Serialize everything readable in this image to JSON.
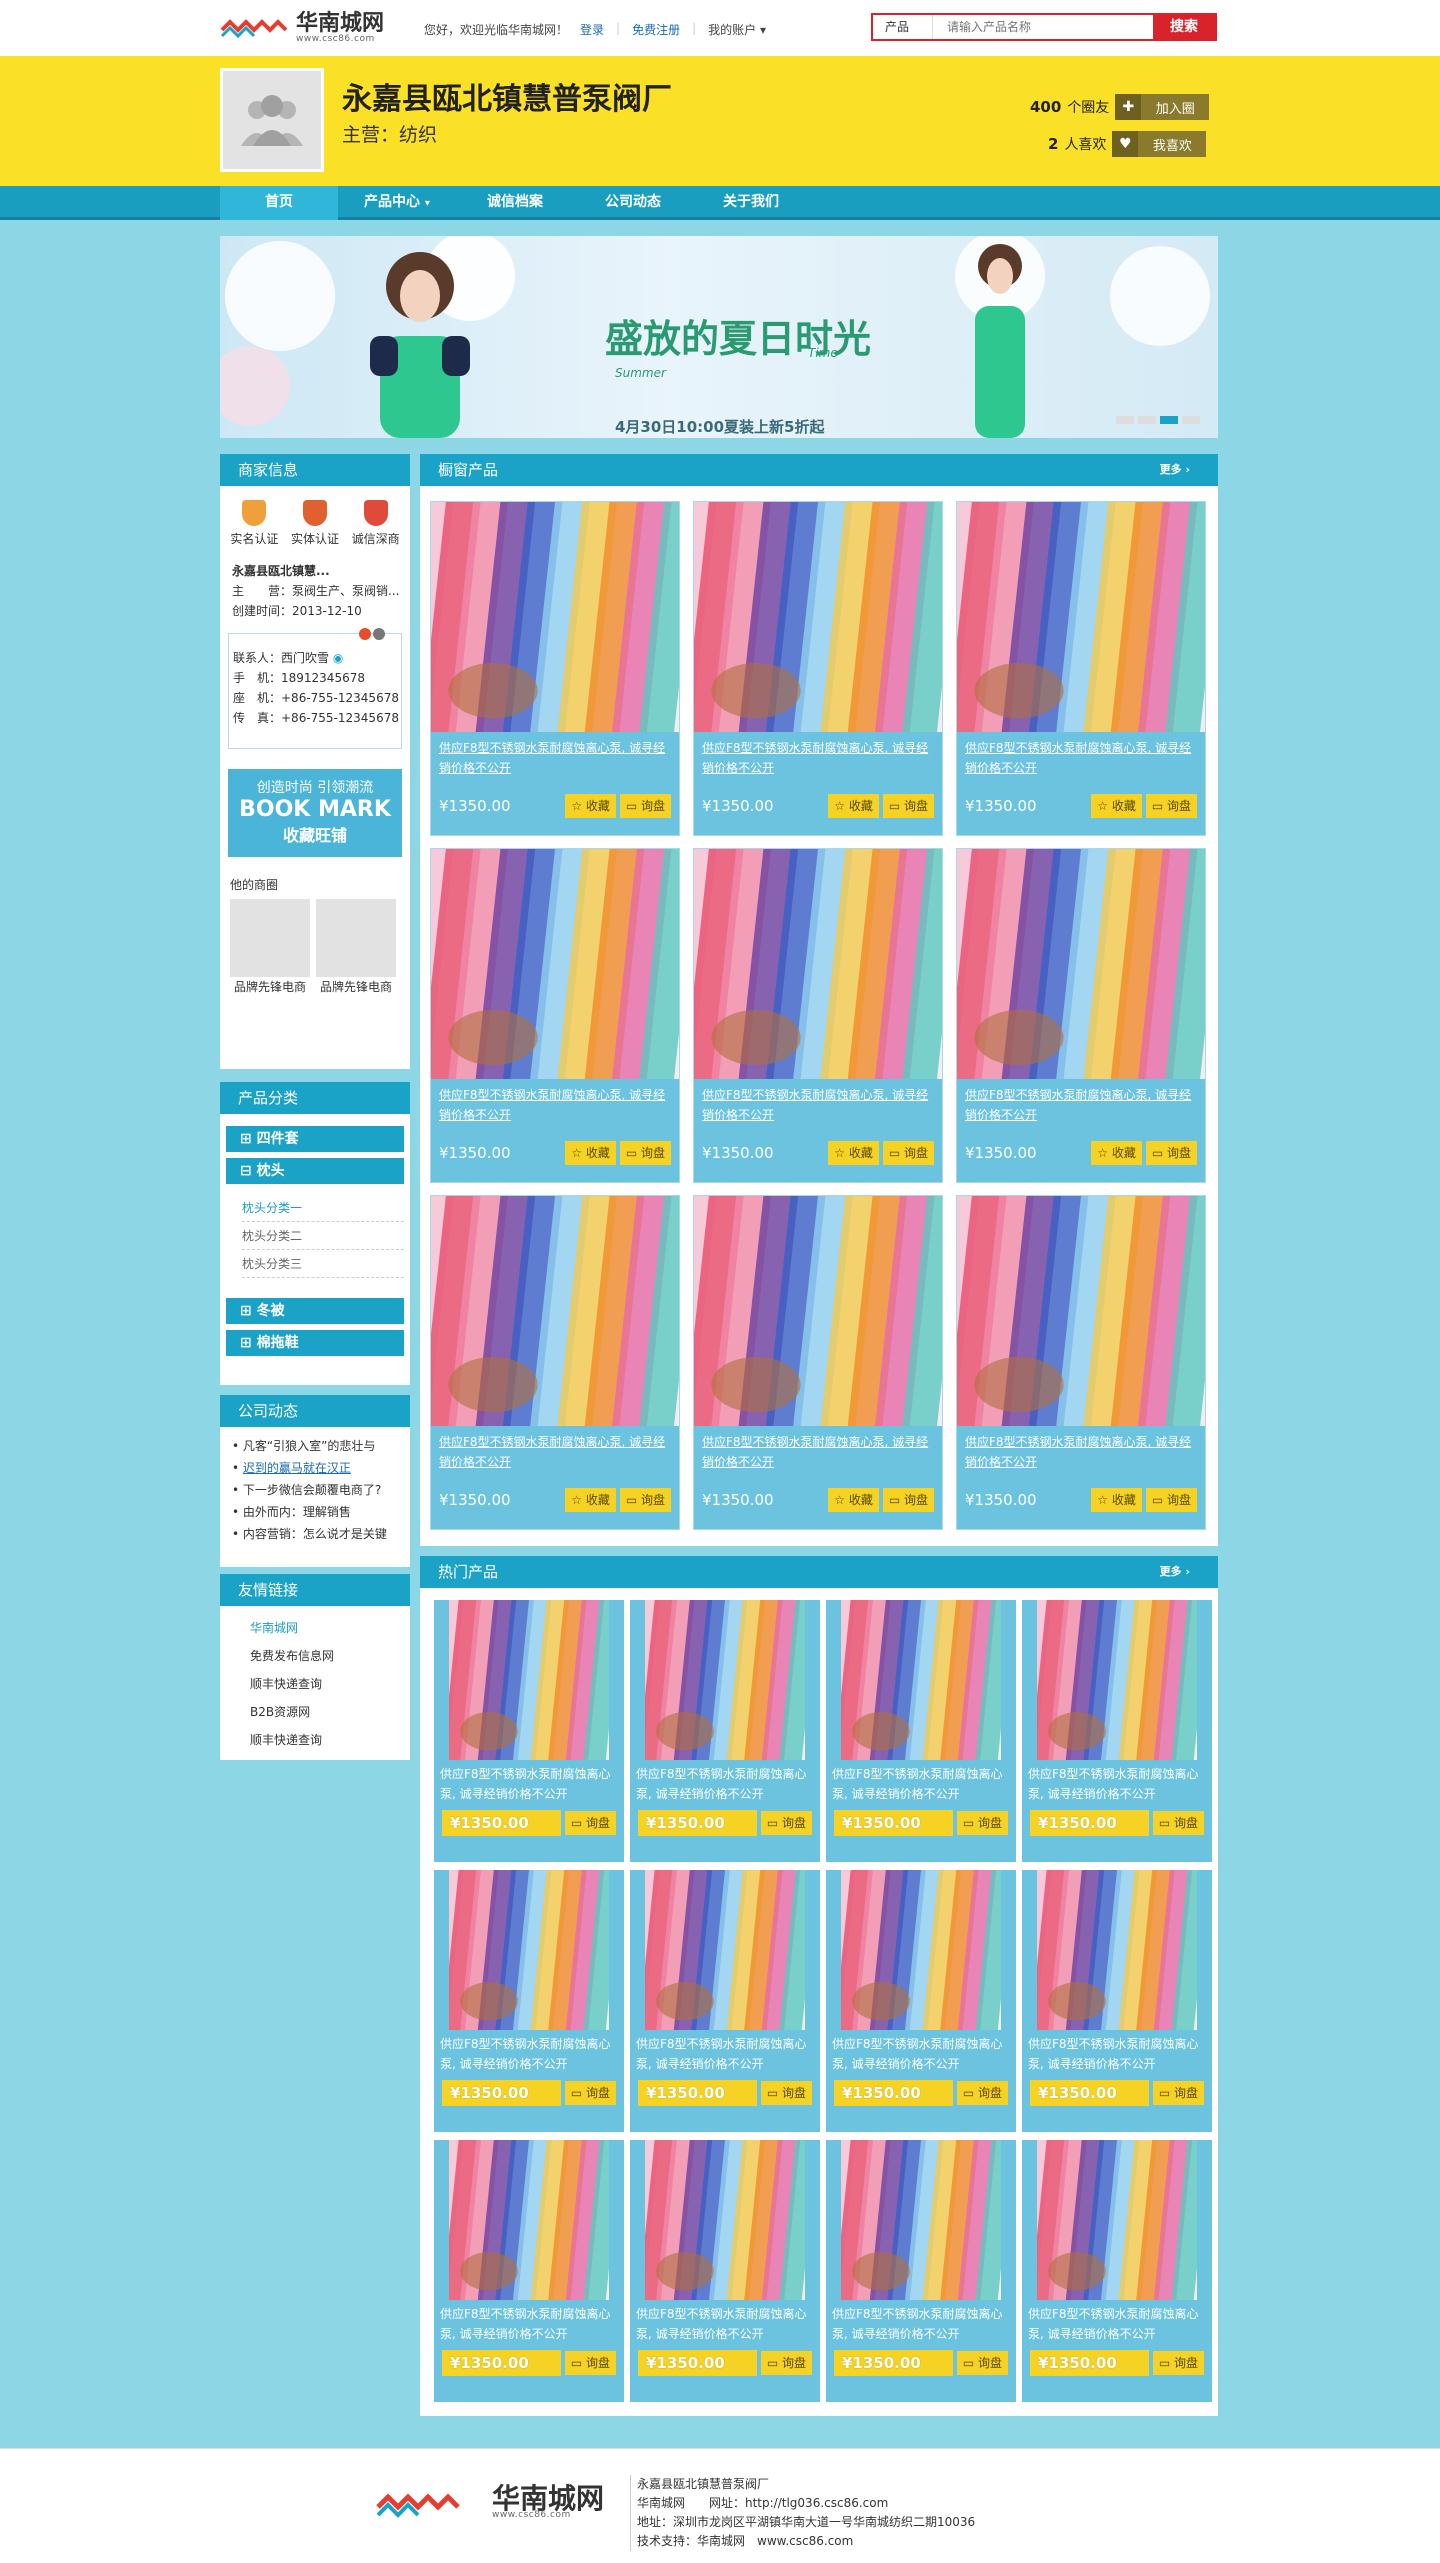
{
  "topbar": {
    "logo_cn": "华南城网",
    "logo_url": "www.csc86.com",
    "greeting": "您好，欢迎光临华南城网！",
    "login": "登录",
    "register": "免费注册",
    "account": "我的账户",
    "search_type": "产品",
    "search_placeholder": "请输入产品名称",
    "search_button": "搜索"
  },
  "header": {
    "company": "永嘉县瓯北镇慧普泵阀厂",
    "main_business": "主营：纺织",
    "fans_count": "400",
    "fans_label": "个圈友",
    "join_label": "加入圈",
    "likes_count": "2",
    "likes_label": "人喜欢",
    "like_btn": "我喜欢"
  },
  "nav": [
    "首页",
    "产品中心",
    "诚信档案",
    "公司动态",
    "关于我们"
  ],
  "banner": {
    "headline": "盛放的夏日时光",
    "summer": "Summer",
    "time": "Time",
    "subtext": "4月30日10:00夏装上新5折起"
  },
  "merchant": {
    "title": "商家信息",
    "badges": [
      "实名认证",
      "实体认证",
      "诚信深商"
    ],
    "name": "永嘉县瓯北镇慧...",
    "main": "主　　营：泵阀生产、泵阀销...",
    "created": "创建时间：2013-12-10",
    "contact_person": "联系人：西门吹雪",
    "mobile": "手　机：18912345678",
    "phone": "座　机：+86-755-12345678",
    "fax": "传　真：+86-755-12345678",
    "bookmark_line1": "创造时尚 引领潮流",
    "bookmark_line2": "BOOK MARK",
    "bookmark_line3": "收藏旺铺",
    "circle_title": "他的商圈",
    "circles": [
      "品牌先锋电商",
      "品牌先锋电商"
    ]
  },
  "category": {
    "title": "产品分类",
    "items": [
      "四件套",
      "枕头",
      "冬被",
      "棉拖鞋"
    ],
    "subitems": [
      "枕头分类一",
      "枕头分类二",
      "枕头分类三"
    ]
  },
  "news": {
    "title": "公司动态",
    "items": [
      "凡客“引狼入室”的悲壮与",
      "迟到的赢马就在汉正",
      "下一步微信会颠覆电商了?",
      "由外而内：理解销售",
      "内容营销：怎么说才是关键"
    ]
  },
  "links": {
    "title": "友情链接",
    "items": [
      "华南城网",
      "免费发布信息网",
      "顺丰快递查询",
      "B2B资源网",
      "顺丰快递查询"
    ]
  },
  "window": {
    "title": "橱窗产品",
    "more": "更多",
    "desc": "供应F8型不锈钢水泵耐腐蚀离心泵, 诚寻经销价格不公开",
    "price": "¥1350.00",
    "fav": "收藏",
    "ask": "询盘"
  },
  "hotp": {
    "title": "热门产品",
    "more": "更多",
    "desc": "供应F8型不锈钢水泵耐腐蚀离心泵, 诚寻经销价格不公开",
    "price": "¥1350.00",
    "ask": "询盘"
  },
  "footer": {
    "company": "永嘉县瓯北镇慧普泵阀厂",
    "site": "华南城网　　网址：http://tlg036.csc86.com",
    "address": "地址：深圳市龙岗区平湖镇华南大道一号华南城纺织二期10036",
    "support": "技术支持：华南城网　www.csc86.com"
  }
}
